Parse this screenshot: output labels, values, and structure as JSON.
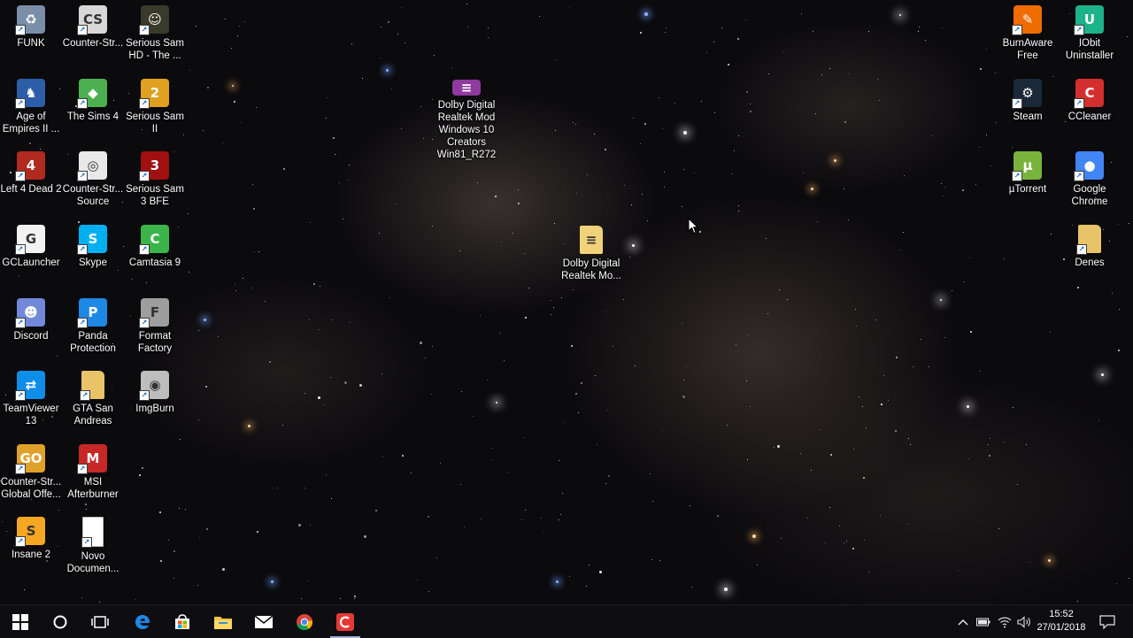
{
  "desktop": {
    "icons": [
      {
        "label": "FUNK",
        "icon": "recycle-bin-icon",
        "color": "#7a8ea8"
      },
      {
        "label": "Counter-Str...",
        "icon": "counter-strike-icon",
        "color": "#d8d8d8"
      },
      {
        "label": "Serious Sam\nHD - The ...",
        "icon": "serious-sam-hd-icon",
        "color": "#3a3a2a"
      },
      {
        "label": "Age of\nEmpires II ...",
        "icon": "age-of-empires-icon",
        "color": "#2c5ea8"
      },
      {
        "label": "The Sims 4",
        "icon": "sims-4-icon",
        "color": "#4caf50"
      },
      {
        "label": "Serious Sam\nII",
        "icon": "serious-sam-2-icon",
        "color": "#e0a020"
      },
      {
        "label": "Left 4 Dead 2",
        "icon": "left-4-dead-2-icon",
        "color": "#b02a20"
      },
      {
        "label": "Counter-Str...\nSource",
        "icon": "counter-strike-source-icon",
        "color": "#e8e8e8"
      },
      {
        "label": "Serious Sam\n3 BFE",
        "icon": "serious-sam-3-icon",
        "color": "#a01010"
      },
      {
        "label": "GCLauncher",
        "icon": "gclauncher-icon",
        "color": "#f2f2f2"
      },
      {
        "label": "Skype",
        "icon": "skype-icon",
        "color": "#00aff0"
      },
      {
        "label": "Camtasia 9",
        "icon": "camtasia-icon",
        "color": "#3bb54a"
      },
      {
        "label": "Discord",
        "icon": "discord-icon",
        "color": "#7289da"
      },
      {
        "label": "Panda\nProtection",
        "icon": "panda-icon",
        "color": "#1e88e5"
      },
      {
        "label": "Format\nFactory",
        "icon": "format-factory-icon",
        "color": "#9e9e9e"
      },
      {
        "label": "TeamViewer\n13",
        "icon": "teamviewer-icon",
        "color": "#0e8ee9"
      },
      {
        "label": "GTA San\nAndreas",
        "icon": "folder-icon",
        "color": "#e8c368"
      },
      {
        "label": "ImgBurn",
        "icon": "imgburn-icon",
        "color": "#bdbdbd"
      },
      {
        "label": "Counter-Str...\nGlobal Offe...",
        "icon": "csgo-icon",
        "color": "#e0a12a"
      },
      {
        "label": "MSI\nAfterburner",
        "icon": "msi-afterburner-icon",
        "color": "#c62828"
      },
      {
        "label": "Insane 2",
        "icon": "insane-2-icon",
        "color": "#f5a623"
      },
      {
        "label": "Novo\nDocumen...",
        "icon": "text-document-icon",
        "color": "#ffffff"
      },
      {
        "label": "Dolby Digital\nRealtek Mod\nWindows 10\nCreators\nWin81_R272",
        "icon": "winrar-archive-icon",
        "color": "#8e3a9e"
      },
      {
        "label": "Dolby Digital\nRealtek Mo...",
        "icon": "zip-folder-icon",
        "color": "#f0d27a"
      },
      {
        "label": "BurnAware\nFree",
        "icon": "burnaware-icon",
        "color": "#ef6c00"
      },
      {
        "label": "IObit\nUninstaller",
        "icon": "iobit-uninstaller-icon",
        "color": "#1db38a"
      },
      {
        "label": "Steam",
        "icon": "steam-icon",
        "color": "#1b2838"
      },
      {
        "label": "CCleaner",
        "icon": "ccleaner-icon",
        "color": "#d32f2f"
      },
      {
        "label": "µTorrent",
        "icon": "utorrent-icon",
        "color": "#78b43c"
      },
      {
        "label": "Google\nChrome",
        "icon": "chrome-icon",
        "color": "#4285f4"
      },
      {
        "label": "Denes",
        "icon": "folder-icon",
        "color": "#e8c368"
      }
    ]
  },
  "taskbar": {
    "start": "windows-logo-icon",
    "search": "cortana-circle-icon",
    "task_view": "task-view-icon",
    "pinned": [
      {
        "name": "edge-icon",
        "color": "#1e88e5"
      },
      {
        "name": "store-icon",
        "color": "#2196f3"
      },
      {
        "name": "file-explorer-icon",
        "color": "#f6c343"
      },
      {
        "name": "mail-icon",
        "color": "#ffffff"
      },
      {
        "name": "chrome-icon",
        "color": "#4285f4"
      },
      {
        "name": "camtasia-recorder-icon",
        "color": "#e53935"
      }
    ],
    "tray": {
      "chevron": "^",
      "time": "15:52",
      "date": "27/01/2018"
    }
  }
}
